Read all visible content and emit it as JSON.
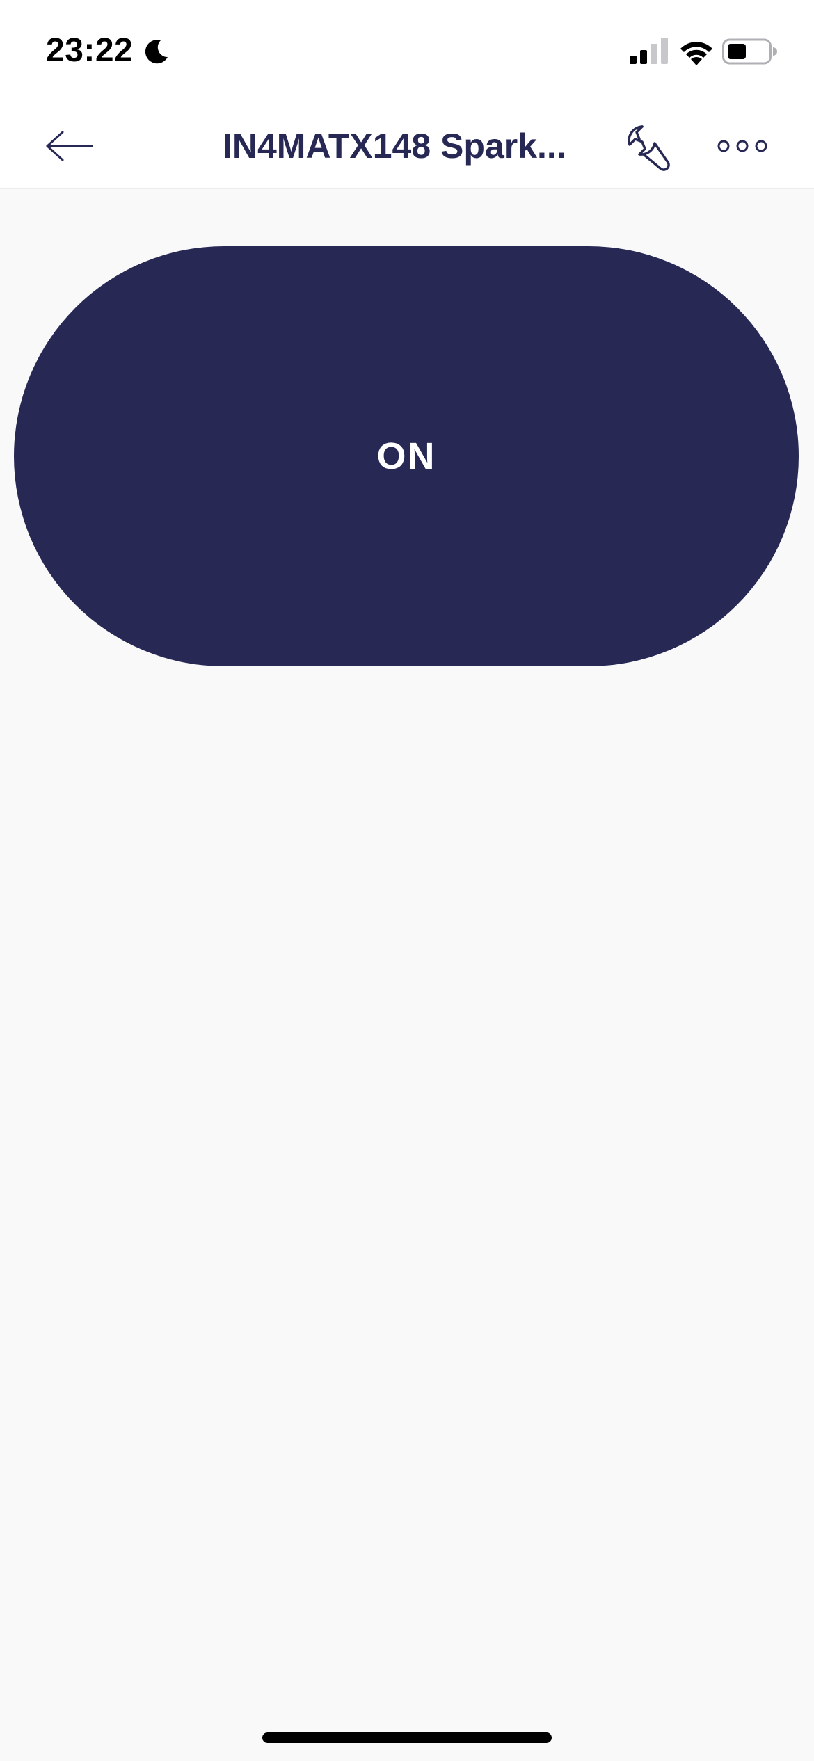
{
  "status_bar": {
    "time": "23:22",
    "moon_icon": "moon-icon",
    "signal_icon": "cellular-signal-icon",
    "wifi_icon": "wifi-icon",
    "battery_icon": "battery-icon",
    "battery_level": 0.4
  },
  "header": {
    "back_icon": "arrow-left-icon",
    "title": "IN4MATX148 Spark...",
    "settings_icon": "wrench-icon",
    "more_icon": "more-horizontal-icon",
    "title_color": "#272954"
  },
  "main": {
    "power_button_label": "ON",
    "button_color": "#272954",
    "background_color": "#f9f9fa"
  }
}
